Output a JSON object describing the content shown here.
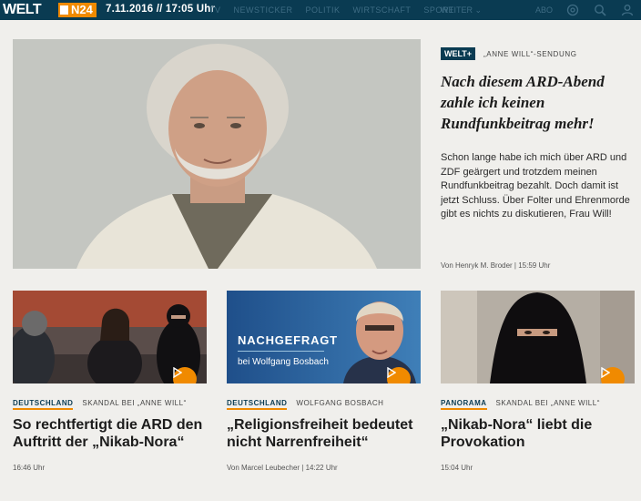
{
  "topbar": {
    "logo_welt": "WELT",
    "logo_n24": "N24",
    "datetime": "7.11.2016 // 17:05 Uhr",
    "nav": [
      "TV",
      "NEWSTICKER",
      "POLITIK",
      "WIRTSCHAFT",
      "SPORT"
    ],
    "nav_more": "WEITER ⌄",
    "abo": "ABO"
  },
  "hero": {
    "badge": "WELT+",
    "kicker": "„ANNE WILL“-SENDUNG",
    "title": "Nach diesem ARD-Abend zahle ich keinen Rundfunkbeitrag mehr!",
    "teaser": "Schon lange habe ich mich über ARD und ZDF geärgert und trotzdem meinen Rundfunkbeitrag bezahlt. Doch damit ist jetzt Schluss. Über Folter und Ehrenmorde gibt es nichts zu diskutieren, Frau Will!",
    "byline": "Von Henryk M. Broder  |  15:59 Uhr"
  },
  "cards": [
    {
      "section": "DEUTSCHLAND",
      "topic": "SKANDAL BEI „ANNE WILL“",
      "title": "So rechtfertigt die ARD den Auftritt der „Nikab-Nora“",
      "foot": "16:46 Uhr"
    },
    {
      "section": "DEUTSCHLAND",
      "topic": "WOLFGANG BOSBACH",
      "title": "„Religionsfreiheit bedeutet nicht Narrenfreiheit“",
      "foot": "Von Marcel Leubecher  |  14:22 Uhr",
      "overlay_l1": "NACHGEFRAGT",
      "overlay_l2": "bei Wolfgang Bosbach"
    },
    {
      "section": "PANORAMA",
      "topic": "SKANDAL BEI „ANNE WILL“",
      "title": "„Nikab-Nora“ liebt die Provokation",
      "foot": "15:04 Uhr"
    }
  ],
  "colors": {
    "brand": "#0a3b52",
    "accent": "#f08a00",
    "background": "#f0efec"
  }
}
